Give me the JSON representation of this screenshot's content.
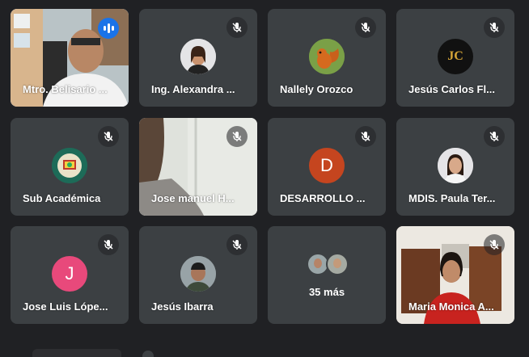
{
  "participants": [
    {
      "name": "Mtro. Belisario ...",
      "status": "speaking",
      "type": "video"
    },
    {
      "name": "Ing. Alexandra ...",
      "status": "muted",
      "type": "photo-avatar"
    },
    {
      "name": "Nallely Orozco",
      "status": "muted",
      "type": "photo-avatar"
    },
    {
      "name": "Jesús Carlos Fl...",
      "status": "muted",
      "type": "logo-avatar",
      "avatar_text": "JC"
    },
    {
      "name": "Sub Académica",
      "status": "muted",
      "type": "logo-avatar"
    },
    {
      "name": "Jose manuel H...",
      "status": "muted",
      "type": "video"
    },
    {
      "name": "DESARROLLO ...",
      "status": "muted",
      "type": "letter-avatar",
      "avatar_letter": "D",
      "avatar_color": "#c5451f"
    },
    {
      "name": "MDIS. Paula Ter...",
      "status": "muted",
      "type": "photo-avatar"
    },
    {
      "name": "Jose Luis Lópe...",
      "status": "muted",
      "type": "letter-avatar",
      "avatar_letter": "J",
      "avatar_color": "#e8497b"
    },
    {
      "name": "Jesús Ibarra",
      "status": "muted",
      "type": "photo-avatar"
    },
    {
      "name": "",
      "type": "more",
      "more_label": "35 más"
    },
    {
      "name": "Maria Monica A...",
      "status": "muted",
      "type": "video"
    }
  ],
  "colors": {
    "background": "#202124",
    "tile": "#3c4043",
    "speaking_border": "#8ab4f8",
    "speaking_indicator": "#1a73e8"
  }
}
